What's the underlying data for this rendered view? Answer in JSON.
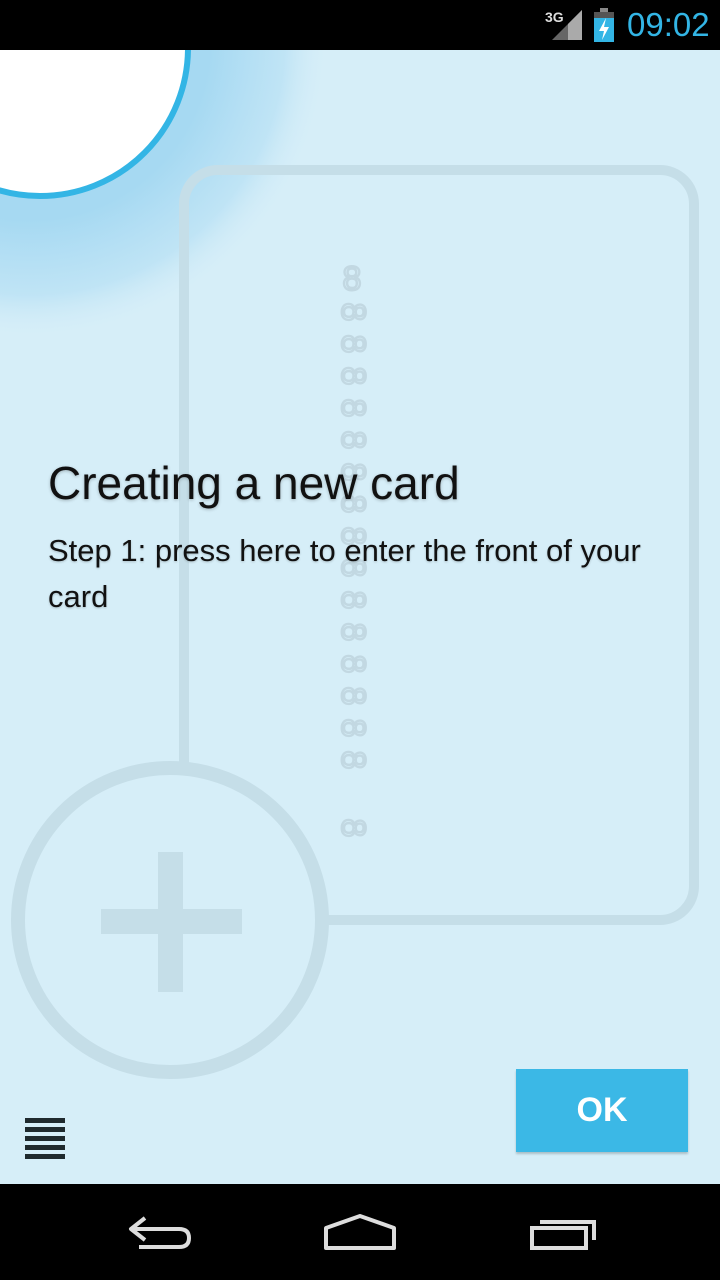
{
  "status_bar": {
    "network": "3G",
    "time": "09:02",
    "accent_color": "#33b5e5"
  },
  "illustration": {
    "card_number_digits": "8888888888888888"
  },
  "tutorial": {
    "title": "Creating a new card",
    "description": "Step 1: press here to enter the front of your card",
    "ok_label": "OK"
  },
  "menu": {
    "icon": "menu-icon"
  },
  "nav_bar": {
    "back_icon": "back-icon",
    "home_icon": "home-icon",
    "recents_icon": "recent-apps-icon"
  }
}
